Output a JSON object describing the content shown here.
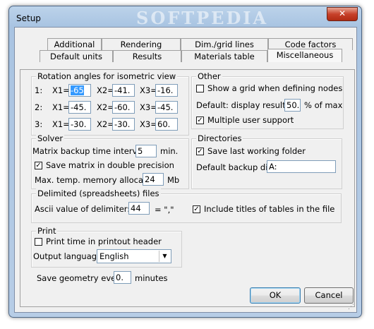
{
  "window": {
    "title": "Setup",
    "watermark": "SOFTPEDIA",
    "close_glyph": "✕"
  },
  "tabs_row1": [
    "Additional",
    "Rendering",
    "Dim./grid lines",
    "Code factors"
  ],
  "tabs_row2": [
    "Default units",
    "Results",
    "Materials table",
    "Miscellaneous"
  ],
  "active_tab": "Miscellaneous",
  "rotation": {
    "title": "Rotation angles for isometric view",
    "rows": [
      {
        "label": "1:",
        "x1": "-65",
        "x2": "-41.",
        "x3": "-16."
      },
      {
        "label": "2:",
        "x1": "-45.",
        "x2": "-60.",
        "x3": "-45."
      },
      {
        "label": "3:",
        "x1": "-30.",
        "x2": "-30.",
        "x3": "60."
      }
    ],
    "x1_label": "X1=",
    "x2_label": "X2=",
    "x3_label": "X3="
  },
  "other": {
    "title": "Other",
    "show_grid_label": "Show a grid when defining nodes",
    "show_grid_checked": false,
    "display_results_label": "Default: display results >",
    "display_results_value": "50.",
    "display_results_unit": "% of max",
    "multi_user_label": "Multiple user support",
    "multi_user_checked": true
  },
  "solver": {
    "title": "Solver",
    "backup_label": "Matrix backup time interval =",
    "backup_value": "5",
    "backup_unit": "min.",
    "double_label": "Save matrix in double precision",
    "double_checked": true,
    "memory_label": "Max. temp. memory allocated:",
    "memory_value": "24",
    "memory_unit": "Mb"
  },
  "directories": {
    "title": "Directories",
    "save_last_label": "Save last working folder",
    "save_last_checked": true,
    "backup_dir_label": "Default backup dir.:",
    "backup_dir_value": "A:"
  },
  "delimited": {
    "title": "Delimited (spreadsheets) files",
    "ascii_label": "Ascii value of delimiter:",
    "ascii_value": "44",
    "ascii_char": "= \",\"",
    "include_titles_label": "Include titles of tables in the file",
    "include_titles_checked": true
  },
  "print": {
    "title": "Print",
    "time_label": "Print time in printout header",
    "time_checked": false,
    "language_label": "Output language:",
    "language_value": "English"
  },
  "save_geometry": {
    "label": "Save geometry every",
    "value": "0.",
    "unit": "minutes"
  },
  "buttons": {
    "ok": "OK",
    "cancel": "Cancel"
  }
}
